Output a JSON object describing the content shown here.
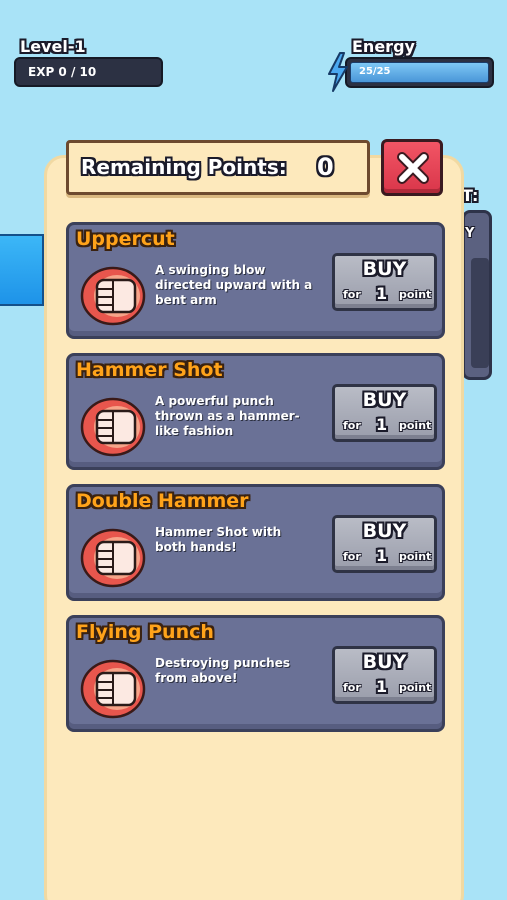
{
  "hud": {
    "level_label": "Level-1",
    "exp_text": "EXP 0 / 10",
    "energy_label": "Energy",
    "energy_text": "25/25",
    "energy_fraction": 1.0
  },
  "panel": {
    "points_label": "Remaining Points:",
    "points_value": "0"
  },
  "background": {
    "side_text_top": "T:",
    "side_text_mid": "Y"
  },
  "moves": [
    {
      "title": "Uppercut",
      "description": "A swinging blow directed upward with a bent arm",
      "buy_label": "BUY",
      "for_label": "for",
      "cost": "1",
      "unit": "point"
    },
    {
      "title": "Hammer Shot",
      "description": "A powerful punch thrown as a hammer-like fashion",
      "buy_label": "BUY",
      "for_label": "for",
      "cost": "1",
      "unit": "point"
    },
    {
      "title": "Double Hammer",
      "description": "Hammer Shot with both hands!",
      "buy_label": "BUY",
      "for_label": "for",
      "cost": "1",
      "unit": "point"
    },
    {
      "title": "Flying Punch",
      "description": "Destroying punches from above!",
      "buy_label": "BUY",
      "for_label": "for",
      "cost": "1",
      "unit": "point"
    }
  ],
  "colors": {
    "background": "#a9e3f7",
    "panel": "#fde9bc",
    "card": "#6a7196",
    "title_orange": "#ffa31a",
    "close_red": "#e84456",
    "buy_gray": "#aaadb9"
  }
}
